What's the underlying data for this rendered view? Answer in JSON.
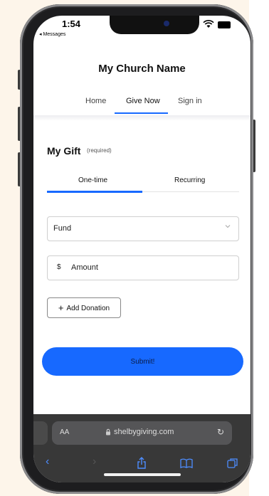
{
  "status_bar": {
    "time": "1:54",
    "back_app": "◂ Messages"
  },
  "site": {
    "church_name": "My Church Name"
  },
  "nav": {
    "items": [
      {
        "label": "Home"
      },
      {
        "label": "Give Now"
      },
      {
        "label": "Sign in"
      }
    ],
    "active": "Give Now"
  },
  "gift": {
    "title": "My Gift",
    "required_note": "(required)",
    "frequency_tabs": [
      {
        "label": "One-time"
      },
      {
        "label": "Recurring"
      }
    ],
    "active_tab": "One-time",
    "fund": {
      "label": "Fund"
    },
    "amount": {
      "currency": "$",
      "placeholder": "Amount",
      "value": ""
    },
    "add_donation_label": "Add Donation",
    "submit_label": "Submit!"
  },
  "browser": {
    "aa_label": "AA",
    "url": "shelbygiving.com"
  },
  "icons": {
    "wifi": "wifi-icon",
    "battery": "battery-icon",
    "chevron": "chevron-down-icon",
    "plus": "plus-icon",
    "lock": "lock-icon",
    "reload": "reload-icon",
    "back": "back-arrow-icon",
    "forward": "forward-arrow-icon",
    "share": "share-icon",
    "bookmarks": "bookmarks-icon",
    "tabs": "tabs-icon"
  },
  "colors": {
    "accent": "#1769ff",
    "toolbar": "#383838",
    "page_background": "#fdf5ea"
  }
}
